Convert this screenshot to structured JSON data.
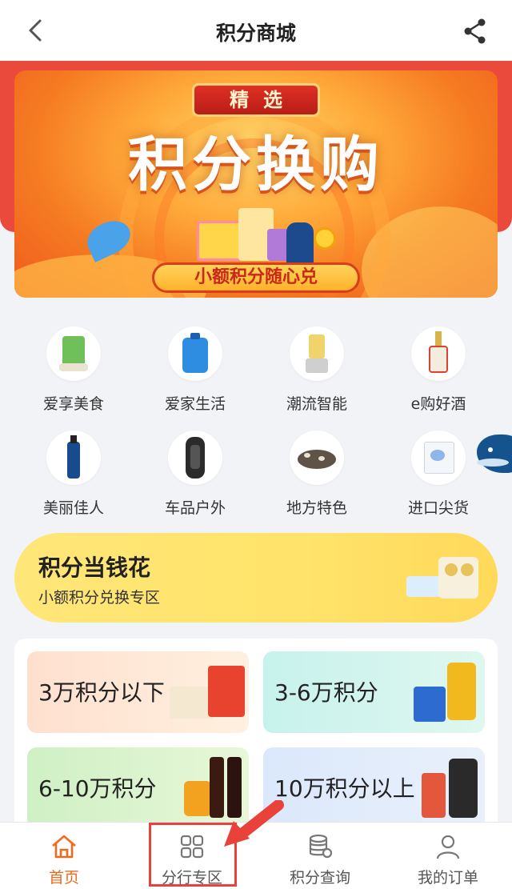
{
  "header": {
    "title": "积分商城",
    "back_icon": "chevron-left-icon",
    "share_icon": "share-icon"
  },
  "banner": {
    "tag_top": "精选",
    "title": "积分换购",
    "tag_bottom": "小额积分随心兑"
  },
  "categories": [
    {
      "label": "爱享美食",
      "icon": "rice-bag-icon"
    },
    {
      "label": "爱家生活",
      "icon": "detergent-icon"
    },
    {
      "label": "潮流智能",
      "icon": "blender-icon"
    },
    {
      "label": "e购好酒",
      "icon": "liquor-bottle-icon"
    },
    {
      "label": "美丽佳人",
      "icon": "cosmetic-bottle-icon"
    },
    {
      "label": "车品户外",
      "icon": "car-seat-icon"
    },
    {
      "label": "地方特色",
      "icon": "mushroom-icon"
    },
    {
      "label": "进口尖货",
      "icon": "import-box-icon"
    }
  ],
  "promo": {
    "title": "积分当钱花",
    "subtitle": "小额积分兑换专区"
  },
  "point_ranges": [
    {
      "label": "3万积分以下"
    },
    {
      "label": "3-6万积分"
    },
    {
      "label": "6-10万积分"
    },
    {
      "label": "10万积分以上"
    }
  ],
  "tabbar": {
    "active": "首页",
    "tabs": [
      {
        "label": "首页",
        "icon": "home-icon"
      },
      {
        "label": "分行专区",
        "icon": "grid-icon"
      },
      {
        "label": "积分查询",
        "icon": "coin-stack-icon"
      },
      {
        "label": "我的订单",
        "icon": "user-icon"
      }
    ]
  },
  "colors": {
    "accent": "#f06a1e",
    "header_band": "#ea4a3c",
    "highlight": "#e8423a"
  }
}
